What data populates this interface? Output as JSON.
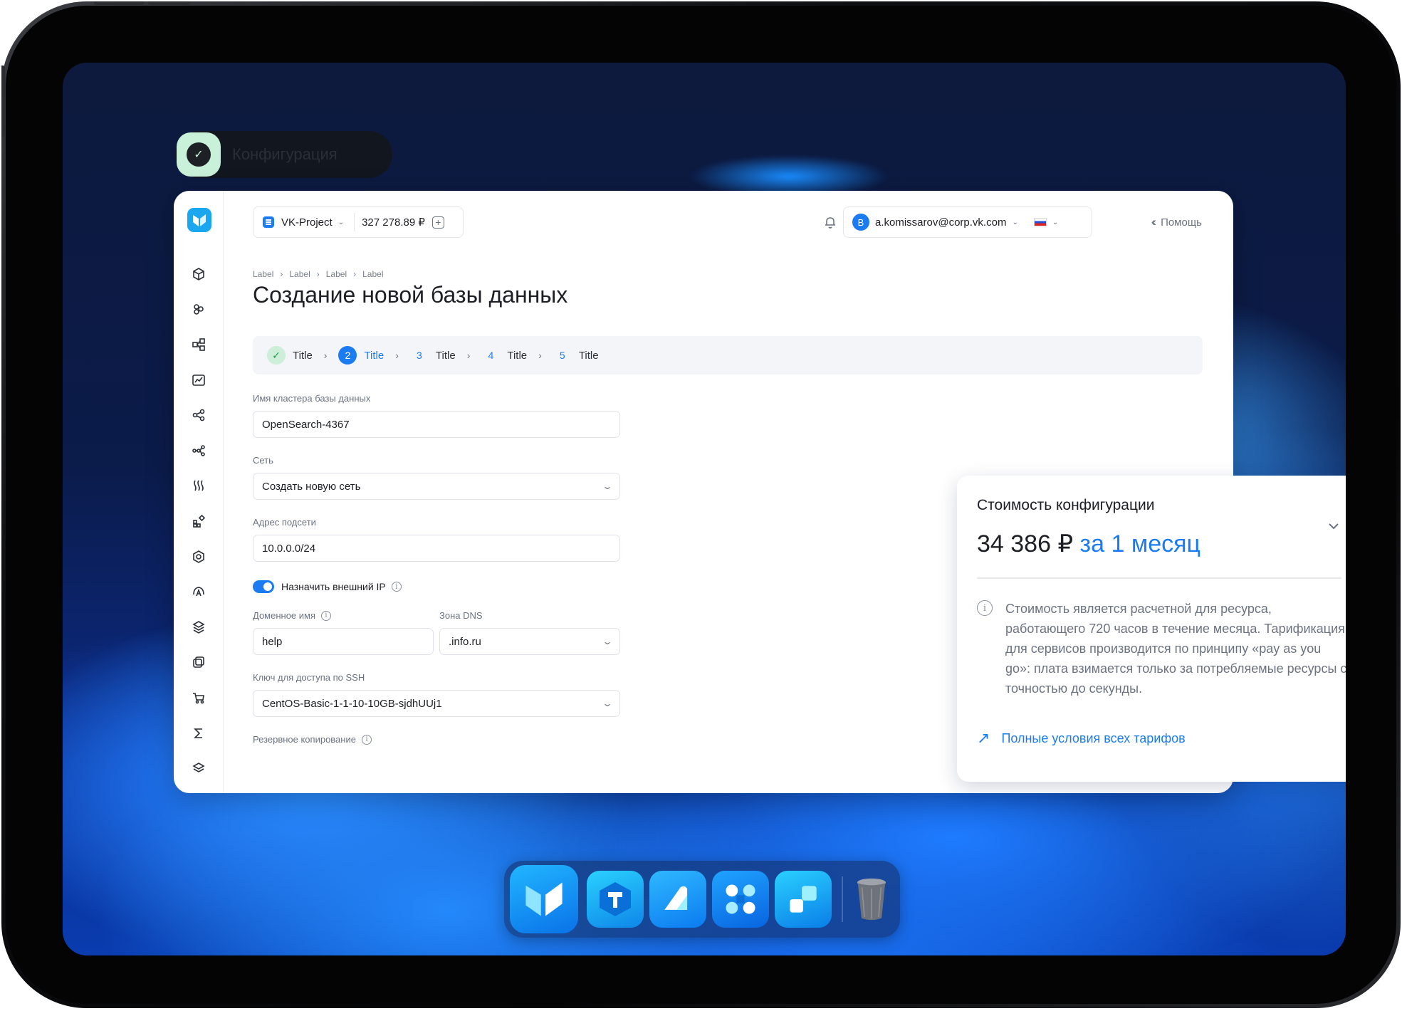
{
  "chip": {
    "label": "Конфигурация"
  },
  "topbar": {
    "project_name": "VK-Project",
    "balance": "327 278.89 ₽",
    "user_email": "a.komissarov@corp.vk.com",
    "user_initial": "B",
    "help_label": "Помощь"
  },
  "breadcrumbs": [
    "Label",
    "Label",
    "Label",
    "Label"
  ],
  "page_title": "Создание новой базы данных",
  "steps": [
    {
      "num": "✓",
      "label": "Title",
      "state": "done"
    },
    {
      "num": "2",
      "label": "Title",
      "state": "active"
    },
    {
      "num": "3",
      "label": "Title",
      "state": "pending"
    },
    {
      "num": "4",
      "label": "Title",
      "state": "pending"
    },
    {
      "num": "5",
      "label": "Title",
      "state": "pending"
    }
  ],
  "form": {
    "cluster_name_label": "Имя кластера базы данных",
    "cluster_name_value": "OpenSearch-4367",
    "network_label": "Сеть",
    "network_value": "Создать новую сеть",
    "subnet_label": "Адрес подсети",
    "subnet_value": "10.0.0.0/24",
    "external_ip_label": "Назначить внешний IP",
    "external_ip_enabled": true,
    "domain_label": "Доменное имя",
    "domain_value": "help",
    "dns_zone_label": "Зона DNS",
    "dns_zone_value": ".info.ru",
    "ssh_label": "Ключ для доступа по SSH",
    "ssh_value": "CentOS-Basic-1-1-10-10GB-sjdhUUj1",
    "backup_label": "Резервное копирование"
  },
  "price_card": {
    "title": "Стоимость конфигурации",
    "price": "34 386 ₽",
    "period": "за 1 месяц",
    "info_text": "Стоимость является расчетной для ресурса, работающего 720 часов в течение месяца. Тарификация для сервисов производится по принципу «pay as you go»: плата взимается только за потребляемые ресурсы с точностью до секунды.",
    "link_label": "Полные условия всех тарифов"
  },
  "colors": {
    "accent": "#1a7cf0",
    "done_step_bg": "#cdeed9",
    "logo": "#1aa7f0"
  },
  "sidebar_icons": [
    "cube-icon",
    "cluster-icon",
    "network-icon",
    "monitoring-icon",
    "share-icon",
    "nodes-icon",
    "waves-icon",
    "apps-icon",
    "security-icon",
    "cloud-icon",
    "layers-icon",
    "copy-icon",
    "cart-icon",
    "sum-icon",
    "stack-icon"
  ],
  "dock_apps": [
    "vk-cloud-icon",
    "tarantool-icon",
    "draw-icon",
    "apps-grid-icon",
    "blocks-icon",
    "trash-icon"
  ]
}
